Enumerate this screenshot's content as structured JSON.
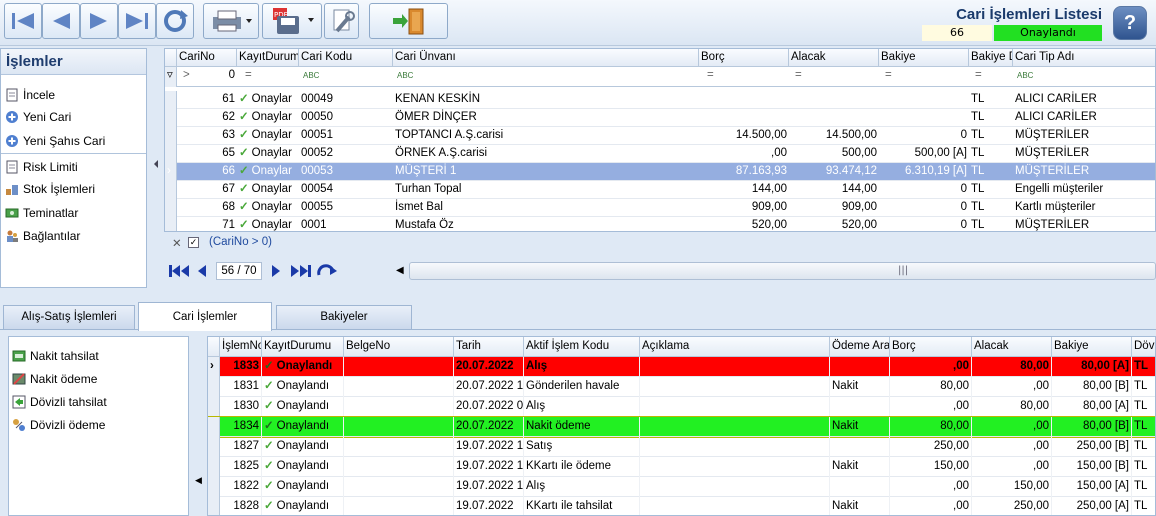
{
  "header": {
    "title": "Cari İşlemleri Listesi",
    "count": "66",
    "status": "Onaylandı"
  },
  "ops": {
    "title": "İşlemler",
    "items": [
      "İncele",
      "Yeni Cari",
      "Yeni Şahıs Cari",
      "Risk Limiti",
      "Stok İşlemleri",
      "Teminatlar",
      "Bağlantılar"
    ]
  },
  "grid1": {
    "headers": [
      "CariNo",
      "KayıtDurumu",
      "Cari Kodu",
      "Cari Ünvanı",
      "Borç",
      "Alacak",
      "Bakiye",
      "Bakiye D",
      "Cari Tip Adı"
    ],
    "filter_value": "0",
    "rows": [
      {
        "no": "61",
        "status": "Onaylar",
        "code": "00049",
        "name": "KENAN KESKİN",
        "borc": "",
        "alacak": "",
        "bakiye": "",
        "bd": "TL",
        "tip": "ALICI CARİLER"
      },
      {
        "no": "62",
        "status": "Onaylar",
        "code": "00050",
        "name": "ÖMER DİNÇER",
        "borc": "",
        "alacak": "",
        "bakiye": "",
        "bd": "TL",
        "tip": "ALICI CARİLER"
      },
      {
        "no": "63",
        "status": "Onaylar",
        "code": "00051",
        "name": "TOPTANCI A.Ş.carisi",
        "borc": "14.500,00",
        "alacak": "14.500,00",
        "bakiye": "0",
        "bd": "TL",
        "tip": "MÜŞTERİLER"
      },
      {
        "no": "65",
        "status": "Onaylar",
        "code": "00052",
        "name": "ÖRNEK A.Ş.carisi",
        "borc": ",00",
        "alacak": "500,00",
        "bakiye": "500,00 [A]",
        "bd": "TL",
        "tip": "MÜŞTERİLER"
      },
      {
        "no": "66",
        "status": "Onaylar",
        "code": "00053",
        "name": "MÜŞTERİ 1",
        "borc": "87.163,93",
        "alacak": "93.474,12",
        "bakiye": "6.310,19 [A]",
        "bd": "TL",
        "tip": "MÜŞTERİLER"
      },
      {
        "no": "67",
        "status": "Onaylar",
        "code": "00054",
        "name": "Turhan Topal",
        "borc": "144,00",
        "alacak": "144,00",
        "bakiye": "0",
        "bd": "TL",
        "tip": "Engelli müşteriler"
      },
      {
        "no": "68",
        "status": "Onaylar",
        "code": "00055",
        "name": "İsmet Bal",
        "borc": "909,00",
        "alacak": "909,00",
        "bakiye": "0",
        "bd": "TL",
        "tip": "Kartlı müşteriler"
      },
      {
        "no": "71",
        "status": "Onaylar",
        "code": "0001",
        "name": "Mustafa Öz",
        "borc": "520,00",
        "alacak": "520,00",
        "bakiye": "0",
        "bd": "TL",
        "tip": "MÜŞTERİLER"
      }
    ],
    "filter_text": "(CariNo > 0)",
    "page": "56 / 70"
  },
  "tabs": [
    "Alış-Satış İşlemleri",
    "Cari İşlemler",
    "Bakiyeler"
  ],
  "ops2": {
    "items": [
      "Nakit tahsilat",
      "Nakit ödeme",
      "Dövizli tahsilat",
      "Dövizli ödeme"
    ]
  },
  "grid2": {
    "headers": [
      "İşlemNo",
      "KayıtDurumu",
      "BelgeNo",
      "Tarih",
      "Aktif İşlem Kodu",
      "Açıklama",
      "Ödeme Araı",
      "Borç",
      "Alacak",
      "Bakiye",
      "Döviz"
    ],
    "rows": [
      {
        "no": "1833",
        "status": "Onaylandı",
        "belge": "",
        "tarih": "20.07.2022",
        "kod": "Alış",
        "acik": "",
        "odeme": "",
        "borc": ",00",
        "alacak": "80,00",
        "bakiye": "80,00 [A]",
        "doviz": "TL"
      },
      {
        "no": "1831",
        "status": "Onaylandı",
        "belge": "",
        "tarih": "20.07.2022 1",
        "kod": "Gönderilen havale",
        "acik": "",
        "odeme": "Nakit",
        "borc": "80,00",
        "alacak": ",00",
        "bakiye": "80,00 [B]",
        "doviz": "TL"
      },
      {
        "no": "1830",
        "status": "Onaylandı",
        "belge": "",
        "tarih": "20.07.2022 0",
        "kod": "Alış",
        "acik": "",
        "odeme": "",
        "borc": ",00",
        "alacak": "80,00",
        "bakiye": "80,00 [A]",
        "doviz": "TL"
      },
      {
        "no": "1834",
        "status": "Onaylandı",
        "belge": "",
        "tarih": "20.07.2022",
        "kod": "Nakit ödeme",
        "acik": "",
        "odeme": "Nakit",
        "borc": "80,00",
        "alacak": ",00",
        "bakiye": "80,00 [B]",
        "doviz": "TL"
      },
      {
        "no": "1827",
        "status": "Onaylandı",
        "belge": "",
        "tarih": "19.07.2022 1",
        "kod": "Satış",
        "acik": "",
        "odeme": "",
        "borc": "250,00",
        "alacak": ",00",
        "bakiye": "250,00 [B]",
        "doviz": "TL"
      },
      {
        "no": "1825",
        "status": "Onaylandı",
        "belge": "",
        "tarih": "19.07.2022 1",
        "kod": "KKartı ile ödeme",
        "acik": "",
        "odeme": "Nakit",
        "borc": "150,00",
        "alacak": ",00",
        "bakiye": "150,00 [B]",
        "doviz": "TL"
      },
      {
        "no": "1822",
        "status": "Onaylandı",
        "belge": "",
        "tarih": "19.07.2022 1",
        "kod": "Alış",
        "acik": "",
        "odeme": "",
        "borc": ",00",
        "alacak": "150,00",
        "bakiye": "150,00 [A]",
        "doviz": "TL"
      },
      {
        "no": "1828",
        "status": "Onaylandı",
        "belge": "",
        "tarih": "19.07.2022",
        "kod": "KKartı ile tahsilat",
        "acik": "",
        "odeme": "Nakit",
        "borc": ",00",
        "alacak": "250,00",
        "bakiye": "250,00 [A]",
        "doviz": "TL"
      }
    ]
  },
  "colors": {
    "selected_row": "#95aee0",
    "red_row": "#ff0000",
    "green_row": "#22f022",
    "status_green": "#22e022"
  }
}
